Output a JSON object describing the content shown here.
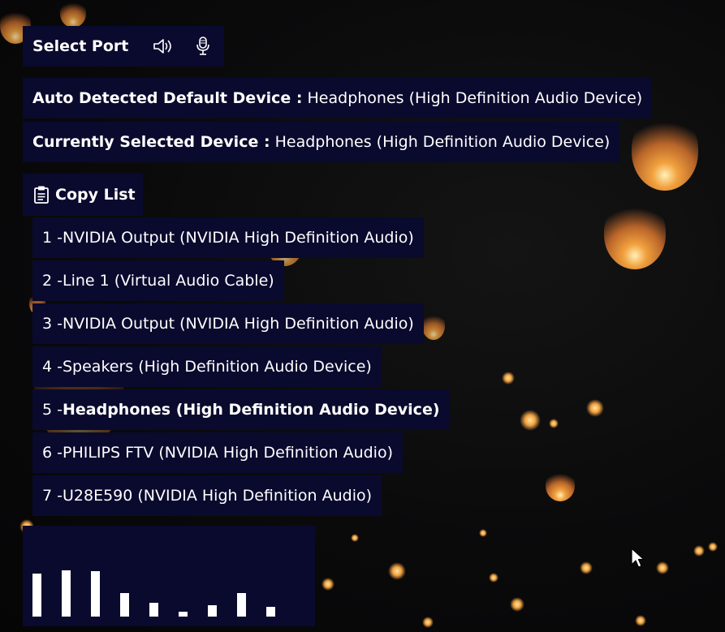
{
  "toolbar": {
    "select_port_label": "Select Port",
    "speaker_icon": "speaker-icon",
    "mic_icon": "microphone-icon"
  },
  "auto_detected": {
    "label": "Auto Detected Default Device :",
    "value": "Headphones (High Definition Audio Device)"
  },
  "currently_selected": {
    "label": "Currently Selected Device :",
    "value": "Headphones (High Definition Audio Device)"
  },
  "copy_list": {
    "label": "Copy List",
    "icon": "clipboard-icon"
  },
  "devices": [
    {
      "prefix": "1 - ",
      "name": "NVIDIA Output (NVIDIA High Definition Audio)"
    },
    {
      "prefix": "2 - ",
      "name": "Line 1 (Virtual Audio Cable)"
    },
    {
      "prefix": "3 - ",
      "name": "NVIDIA Output (NVIDIA High Definition Audio)"
    },
    {
      "prefix": "4 - ",
      "name": "Speakers (High Definition Audio Device)"
    },
    {
      "prefix": "5 - ",
      "name": "Headphones (High Definition Audio Device)",
      "selected": true
    },
    {
      "prefix": "6 - ",
      "name": "PHILIPS FTV (NVIDIA High Definition Audio)"
    },
    {
      "prefix": "7 - ",
      "name": "U28E590 (NVIDIA High Definition Audio)"
    }
  ],
  "level_meter": {
    "levels": [
      0.92,
      0.98,
      0.96,
      0.5,
      0.3,
      0.1,
      0.24,
      0.5,
      0.2
    ]
  },
  "colors": {
    "panel": "#0a0a2e",
    "text": "#ffffff",
    "lantern": "#f1a13e"
  }
}
